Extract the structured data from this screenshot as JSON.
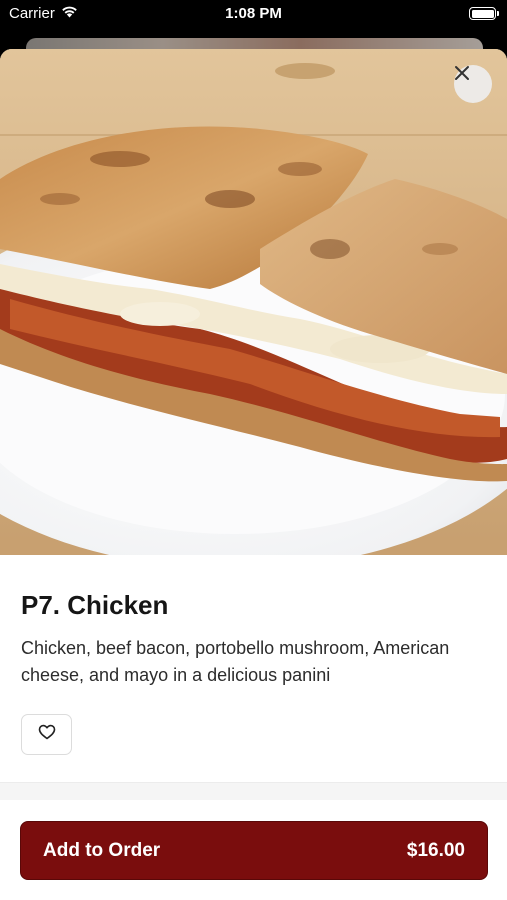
{
  "status_bar": {
    "carrier": "Carrier",
    "time": "1:08 PM",
    "wifi_icon": "wifi-icon",
    "battery_icon": "battery-icon"
  },
  "item": {
    "title": "P7. Chicken",
    "description": "Chicken, beef bacon, portobello mushroom, American cheese, and mayo in a delicious panini",
    "image_alt": "panini-photo"
  },
  "actions": {
    "close_icon": "close-icon",
    "favorite_icon": "heart-icon",
    "add_label": "Add to Order",
    "price": "$16.00"
  },
  "colors": {
    "accent": "#7a0d0d",
    "background": "#ffffff",
    "text": "#161616"
  }
}
